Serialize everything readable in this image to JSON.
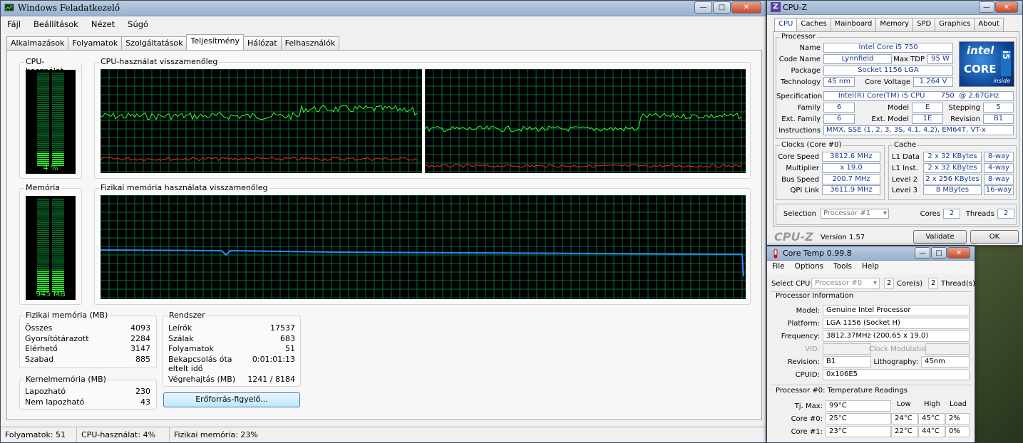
{
  "task_manager": {
    "title": "Windows Feladatkezelő",
    "menu": [
      "Fájl",
      "Beállítások",
      "Nézet",
      "Súgó"
    ],
    "tabs": [
      "Alkalmazások",
      "Folyamatok",
      "Szolgáltatások",
      "Teljesítmény",
      "Hálózat",
      "Felhasználók"
    ],
    "active_tab": "Teljesítmény",
    "cpu_usage_label": "CPU-használat",
    "cpu_usage_value": "4 %",
    "cpu_usage_fraction": 0.04,
    "cpu_history_label": "CPU-használat visszamenőleg",
    "memory_label": "Memória",
    "memory_value": "945 MB",
    "memory_fraction": 0.23,
    "mem_history_label": "Fizikai memória használata visszamenőleg",
    "physical_memory": {
      "title": "Fizikai memória (MB)",
      "rows": [
        [
          "Összes",
          "4093"
        ],
        [
          "Gyorsítótárazott",
          "2284"
        ],
        [
          "Elérhető",
          "3147"
        ],
        [
          "Szabad",
          "885"
        ]
      ]
    },
    "kernel_memory": {
      "title": "Kernelmemória (MB)",
      "rows": [
        [
          "Lapozható",
          "230"
        ],
        [
          "Nem lapozható",
          "43"
        ]
      ]
    },
    "system": {
      "title": "Rendszer",
      "rows": [
        [
          "Leírók",
          "17537"
        ],
        [
          "Szálak",
          "683"
        ],
        [
          "Folyamatok",
          "51"
        ],
        [
          "Bekapcsolás óta eltelt idő",
          "0:01:01:13"
        ],
        [
          "Végrehajtás (MB)",
          "1241 / 8184"
        ]
      ]
    },
    "resource_monitor_button": "Erőforrás-figyelő...",
    "status": [
      "Folyamatok: 51",
      "CPU-használat: 4%",
      "Fizikai memória: 23%"
    ]
  },
  "cpuz": {
    "title": "CPU-Z",
    "tabs": [
      "CPU",
      "Caches",
      "Mainboard",
      "Memory",
      "SPD",
      "Graphics",
      "About"
    ],
    "processor_group": "Processor",
    "name_label": "Name",
    "name": "Intel Core i5 750",
    "codename_label": "Code Name",
    "codename": "Lynnfield",
    "maxtdp_label": "Max TDP",
    "maxtdp": "95 W",
    "package_label": "Package",
    "package": "Socket 1156 LGA",
    "technology_label": "Technology",
    "technology": "45 nm",
    "corevoltage_label": "Core Voltage",
    "corevoltage": "1.264 V",
    "spec_label": "Specification",
    "spec": "Intel(R) Core(TM) i5 CPU       750  @ 2.67GHz",
    "family_label": "Family",
    "family": "6",
    "model_label": "Model",
    "model": "E",
    "stepping_label": "Stepping",
    "stepping": "5",
    "extfamily_label": "Ext. Family",
    "extfamily": "6",
    "extmodel_label": "Ext. Model",
    "extmodel": "1E",
    "revision_label": "Revision",
    "revision": "B1",
    "instructions_label": "Instructions",
    "instructions": "MMX, SSE (1, 2, 3, 3S, 4.1, 4.2), EM64T, VT-x",
    "clocks_group": "Clocks (Core #0)",
    "corespeed_label": "Core Speed",
    "corespeed": "3812.6 MHz",
    "multiplier_label": "Multiplier",
    "multiplier": "x 19.0",
    "busspeed_label": "Bus Speed",
    "busspeed": "200.7 MHz",
    "qpi_label": "QPI Link",
    "qpi": "3611.9 MHz",
    "cache_group": "Cache",
    "cache": [
      [
        "L1 Data",
        "2 x 32 KBytes",
        "8-way"
      ],
      [
        "L1 Inst.",
        "2 x 32 KBytes",
        "4-way"
      ],
      [
        "Level 2",
        "2 x 256 KBytes",
        "8-way"
      ],
      [
        "Level 3",
        "8 MBytes",
        "16-way"
      ]
    ],
    "selection_label": "Selection",
    "selection": "Processor #1",
    "cores_label": "Cores",
    "cores": "2",
    "threads_label": "Threads",
    "threads": "2",
    "brand": "CPU-Z",
    "version": "Version 1.57",
    "validate": "Validate",
    "ok": "OK",
    "logo_intel": "intel",
    "logo_core": "CORE",
    "logo_i5": "i5",
    "logo_inside": "inside"
  },
  "coretemp": {
    "title": "Core Temp 0.99.8",
    "menu": [
      "File",
      "Options",
      "Tools",
      "Help"
    ],
    "selectcpu_label": "Select CPU:",
    "selectcpu": "Processor #0",
    "cores_count": "2",
    "cores_label": "Core(s)",
    "threads_count": "2",
    "threads_label": "Thread(s)",
    "info_group": "Processor Information",
    "model_label": "Model:",
    "model": "Genuine Intel Processor",
    "platform_label": "Platform:",
    "platform": "LGA 1156 (Socket H)",
    "frequency_label": "Frequency:",
    "frequency": "3812.37MHz (200.65 x 19.0)",
    "vid_label": "VID:",
    "clockmod_label": "Clock Modulation:",
    "revision_label": "Revision:",
    "revision": "B1",
    "lithography_label": "Lithography:",
    "lithography": "45nm",
    "cpuid_label": "CPUID:",
    "cpuid": "0x106E5",
    "temp_group": "Processor #0: Temperature Readings",
    "col_low": "Low",
    "col_high": "High",
    "col_load": "Load",
    "tjmax_label": "Tj. Max:",
    "tjmax": "99°C",
    "cores": [
      [
        "Core #0:",
        "25°C",
        "24°C",
        "45°C",
        "2%"
      ],
      [
        "Core #1:",
        "23°C",
        "22°C",
        "44°C",
        "0%"
      ]
    ]
  }
}
